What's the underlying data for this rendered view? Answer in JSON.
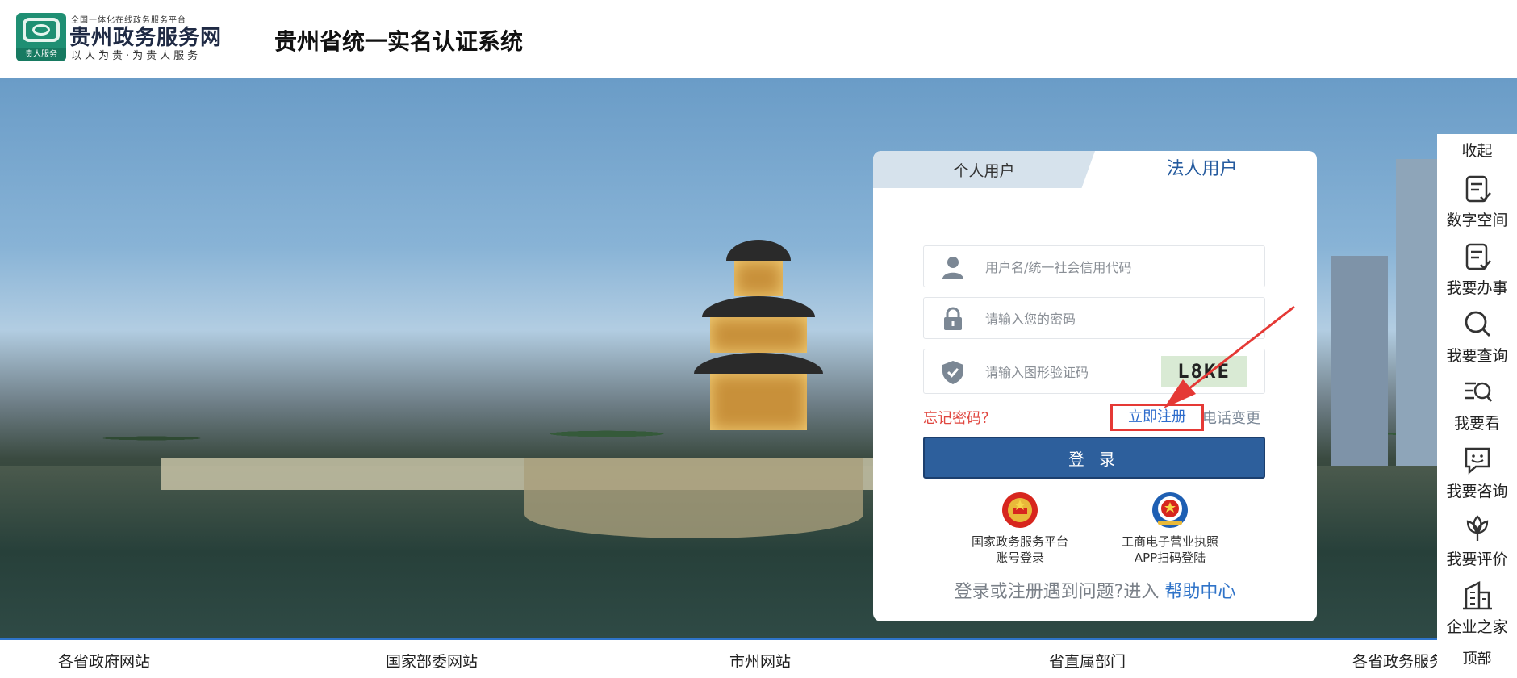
{
  "header": {
    "logo_top_small": "全国一体化在线政务服务平台",
    "logo_name": "贵州政务服务网",
    "logo_slogan": "以人为贵·为贵人服务",
    "logo_badge": "贵人服务",
    "system_title": "贵州省统一实名认证系统"
  },
  "login": {
    "tabs": [
      {
        "label": "个人用户",
        "active": false
      },
      {
        "label": "法人用户",
        "active": true
      }
    ],
    "username_placeholder": "用户名/统一社会信用代码",
    "password_placeholder": "请输入您的密码",
    "captcha_placeholder": "请输入图形验证码",
    "captcha_text": "L8KE",
    "forgot_label": "忘记密码？",
    "register_label": "立即注册",
    "phone_change_label": "电话变更",
    "login_button": "登 录",
    "alt_logins": [
      {
        "line1": "国家政务服务平台",
        "line2": "账号登录",
        "icon": "national-emblem-icon"
      },
      {
        "line1": "工商电子营业执照",
        "line2": "APP扫码登陆",
        "icon": "business-license-icon"
      }
    ],
    "help_prefix": "登录或注册遇到问题?进入",
    "help_link": "帮助中心"
  },
  "sidebar": {
    "collapse": "收起",
    "items": [
      {
        "label": "数字空间",
        "icon": "digital-space-icon"
      },
      {
        "label": "我要办事",
        "icon": "do-business-icon"
      },
      {
        "label": "我要查询",
        "icon": "search-icon"
      },
      {
        "label": "我要看",
        "icon": "view-list-icon"
      },
      {
        "label": "我要咨询",
        "icon": "chat-icon"
      },
      {
        "label": "我要评价",
        "icon": "flower-icon"
      },
      {
        "label": "企业之家",
        "icon": "building-icon"
      }
    ],
    "top": "顶部"
  },
  "bottom_nav": [
    "各省政府网站",
    "国家部委网站",
    "市州网站",
    "省直属部门",
    "各省政务服务"
  ],
  "colors": {
    "primary": "#2d5f9c",
    "link": "#2e6ccc",
    "danger": "#e0463f",
    "annotation": "#e53935",
    "bottom_line": "#2e74c9"
  }
}
